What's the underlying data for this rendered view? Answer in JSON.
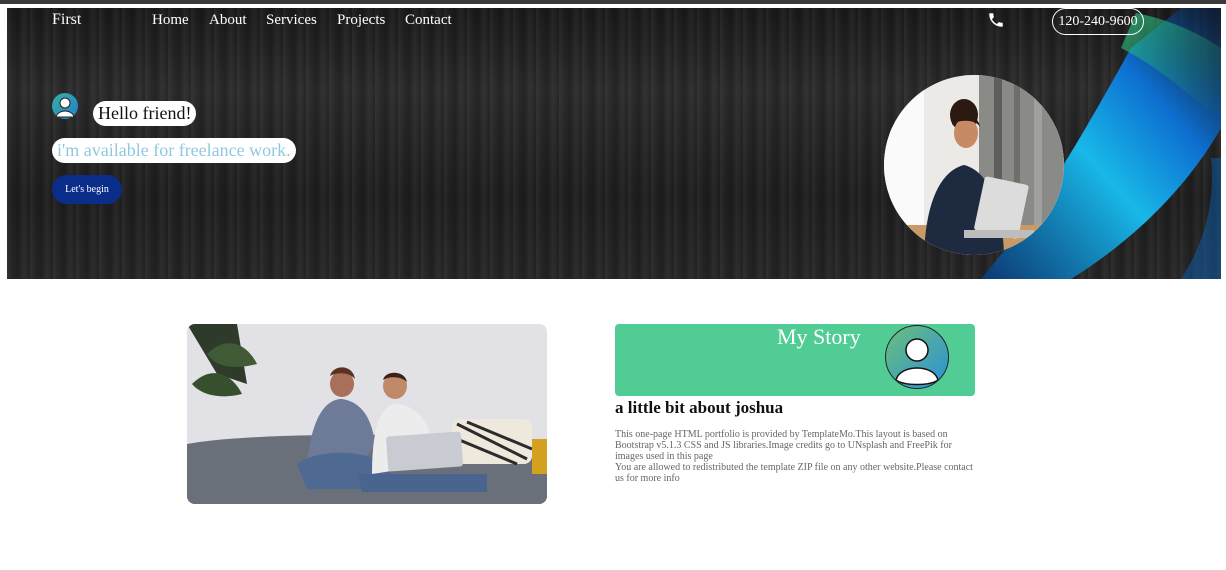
{
  "nav": {
    "brand": "First",
    "links": [
      "Home",
      "About",
      "Services",
      "Projects",
      "Contact"
    ],
    "phone_icon": "phone-icon",
    "phone_number": "120-240-9600"
  },
  "hero": {
    "greeting": "Hello friend!",
    "tagline": "i'm available for freelance work.",
    "cta_label": "Let's begin",
    "accent_color": "#0a2d8a"
  },
  "story": {
    "title": "My Story",
    "heading": "a little bit about joshua",
    "paragraph1": "This one-page HTML portfolio is provided by TemplateMo.This layout is based on Bootstrap v5.1.3 CSS and JS libraries.Image credits go to UNsplash and FreePik for images used in this page",
    "paragraph2": "You are allowed to redistributed the template ZIP file on any other website.Please contact us for more info",
    "box_color": "#52cc95"
  }
}
